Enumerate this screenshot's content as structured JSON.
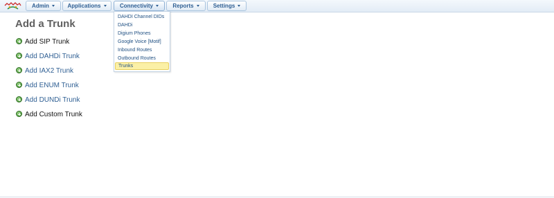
{
  "menubar": {
    "items": [
      {
        "label": "Admin"
      },
      {
        "label": "Applications"
      },
      {
        "label": "Connectivity"
      },
      {
        "label": "Reports"
      },
      {
        "label": "Settings"
      }
    ]
  },
  "dropdown": {
    "items": [
      {
        "label": "DAHDI Channel DIDs"
      },
      {
        "label": "DAHDi"
      },
      {
        "label": "Digium Phones"
      },
      {
        "label": "Google Voice [Motif]"
      },
      {
        "label": "Inbound Routes"
      },
      {
        "label": "Outbound Routes"
      },
      {
        "label": "Trunks"
      }
    ],
    "highlighted": "Trunks"
  },
  "main": {
    "title": "Add a Trunk",
    "links": [
      {
        "label": "Add SIP Trunk",
        "color": "#111111"
      },
      {
        "label": "Add DAHDi Trunk",
        "color": "#2f5f93"
      },
      {
        "label": "Add IAX2 Trunk",
        "color": "#2f5f93"
      },
      {
        "label": "Add ENUM Trunk",
        "color": "#2f5f93"
      },
      {
        "label": "Add DUNDi Trunk",
        "color": "#2f5f93"
      },
      {
        "label": "Add Custom Trunk",
        "color": "#111111"
      }
    ]
  },
  "icons": {
    "logo": "freepbx-logo",
    "link_icon": "green-plus-circle-icon"
  }
}
